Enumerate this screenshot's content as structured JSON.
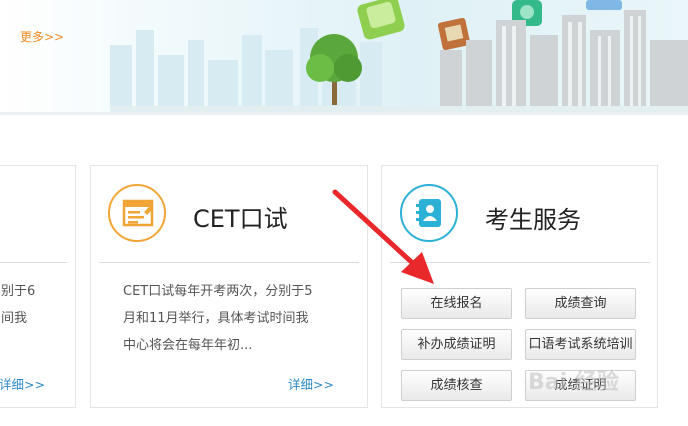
{
  "banner": {
    "more_label": "更多>>"
  },
  "left_card": {
    "line1": "别于6",
    "line2": "间我",
    "detail_label": "详细>>"
  },
  "cet_card": {
    "title": "CET口试",
    "lines": [
      "CET口试每年开考两次，分别于5",
      "月和11月举行，具体考试时间我",
      "中心将会在每年年初..."
    ],
    "detail_label": "详细>>"
  },
  "service_card": {
    "title": "考生服务",
    "buttons": [
      "在线报名",
      "成绩查询",
      "补办成绩证明",
      "口语考试系统培训",
      "成绩核查",
      "成绩证明"
    ]
  },
  "watermark": {
    "text": "Bai 经验"
  },
  "colors": {
    "orange": "#f08a1f",
    "blue_link": "#2b8ac6",
    "orange_icon": "#f0a637",
    "blue_icon": "#2bb0d6",
    "arrow_red": "#e8282b"
  }
}
